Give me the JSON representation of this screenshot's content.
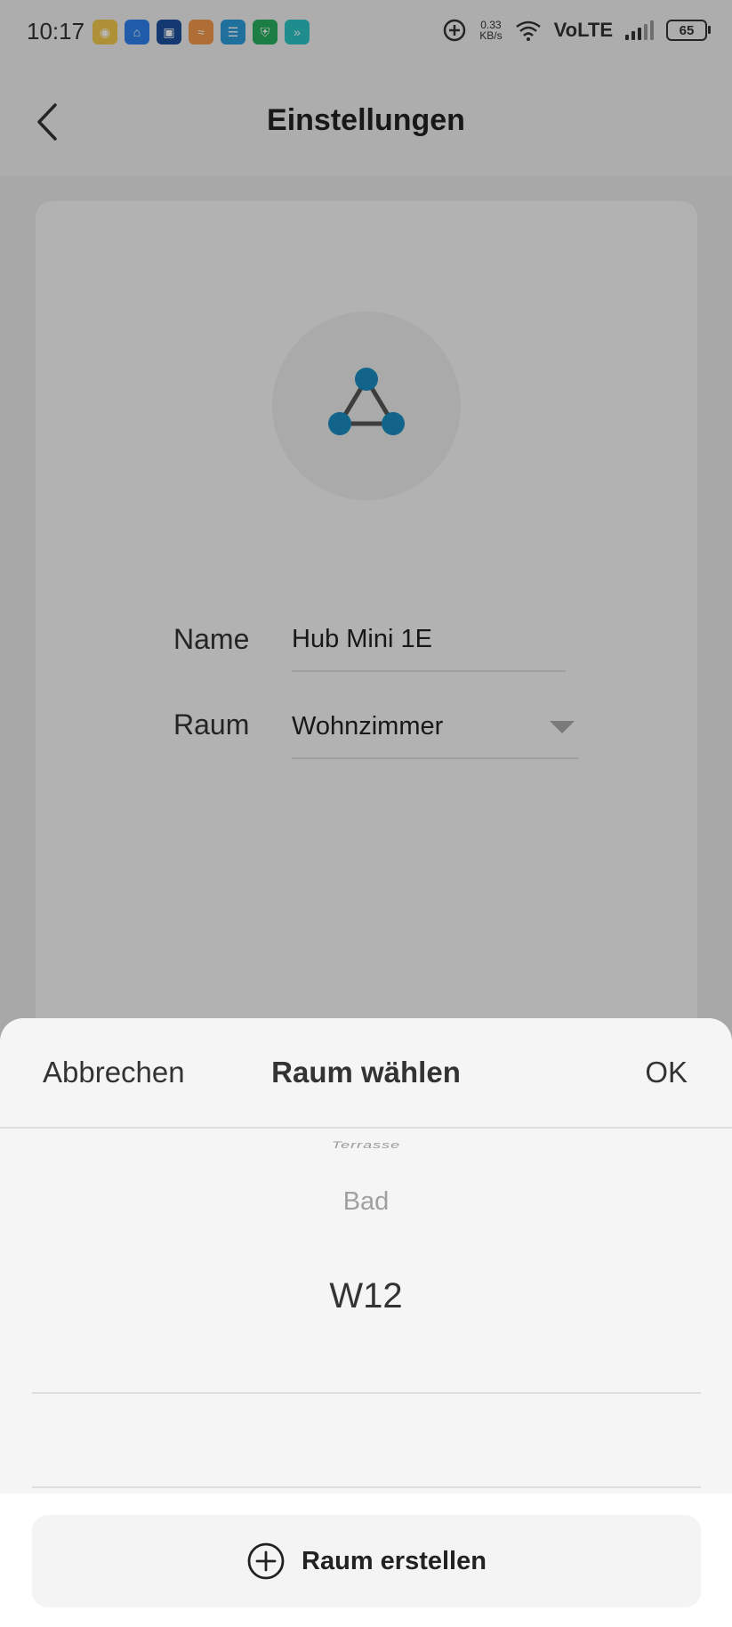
{
  "status_bar": {
    "time": "10:17",
    "net_speed_value": "0.33",
    "net_speed_unit": "KB/s",
    "network": "VoLTE",
    "battery": "65"
  },
  "header": {
    "title": "Einstellungen"
  },
  "device": {
    "icon": "hub-network-icon",
    "accent_color": "#1a8bbf",
    "name_label": "Name",
    "name_value": "Hub Mini 1E",
    "room_label": "Raum",
    "room_value": "Wohnzimmer"
  },
  "sheet": {
    "cancel_label": "Abbrechen",
    "title": "Raum wählen",
    "ok_label": "OK",
    "picker": {
      "items": [
        "Terrasse",
        "Bad",
        "W12"
      ],
      "selected_index": 2
    },
    "create_label": "Raum erstellen"
  }
}
